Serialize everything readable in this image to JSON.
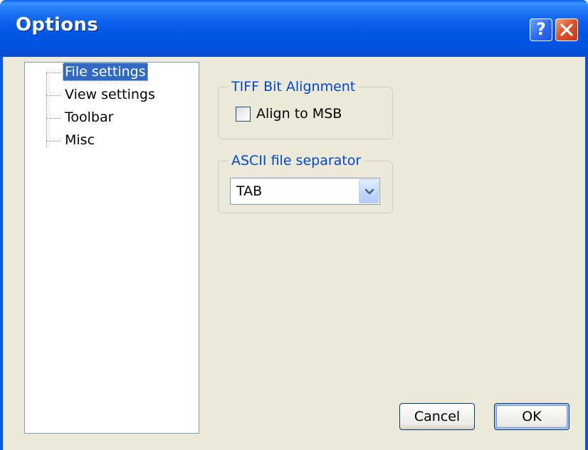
{
  "window": {
    "title": "Options",
    "help_label": "?",
    "close_icon": "close-icon"
  },
  "tree": {
    "items": [
      {
        "label": "File settings",
        "selected": true
      },
      {
        "label": "View settings",
        "selected": false
      },
      {
        "label": "Toolbar",
        "selected": false
      },
      {
        "label": "Misc",
        "selected": false
      }
    ]
  },
  "tiff_group": {
    "legend": "TIFF Bit Alignment",
    "checkbox_label": "Align to MSB",
    "checked": false
  },
  "ascii_group": {
    "legend": "ASCII file separator",
    "selected_value": "TAB"
  },
  "buttons": {
    "cancel_label": "Cancel",
    "ok_label": "OK"
  },
  "colors": {
    "title_bar": "#0054e3",
    "dialog_background": "#ece9d8",
    "selection": "#316ac5",
    "group_legend": "#0046d5"
  }
}
